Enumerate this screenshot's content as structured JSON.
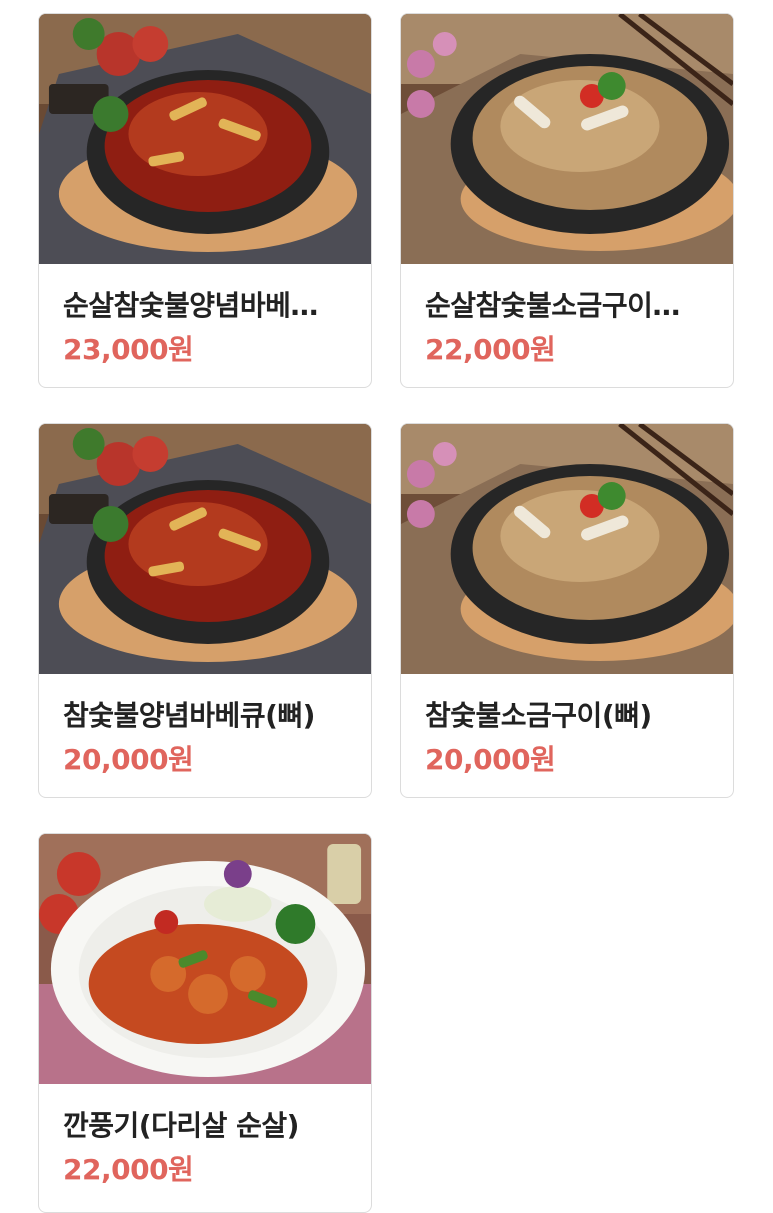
{
  "menu_items": [
    {
      "name": "순살참숯불양념바베…",
      "price": "23,000원",
      "photo": "spicy-bbq-chicken-image"
    },
    {
      "name": "순살참숯불소금구이…",
      "price": "22,000원",
      "photo": "salt-grilled-chicken-image"
    },
    {
      "name": "참숯불양념바베큐(뼈)",
      "price": "20,000원",
      "photo": "spicy-bbq-chicken-image"
    },
    {
      "name": "참숯불소금구이(뼈)",
      "price": "20,000원",
      "photo": "salt-grilled-chicken-image"
    },
    {
      "name": "깐풍기(다리살 순살)",
      "price": "22,000원",
      "photo": "kkanpunggi-image"
    }
  ],
  "colors": {
    "price": "#e0655d",
    "name": "#222222",
    "card_border": "#dcdcdc"
  }
}
